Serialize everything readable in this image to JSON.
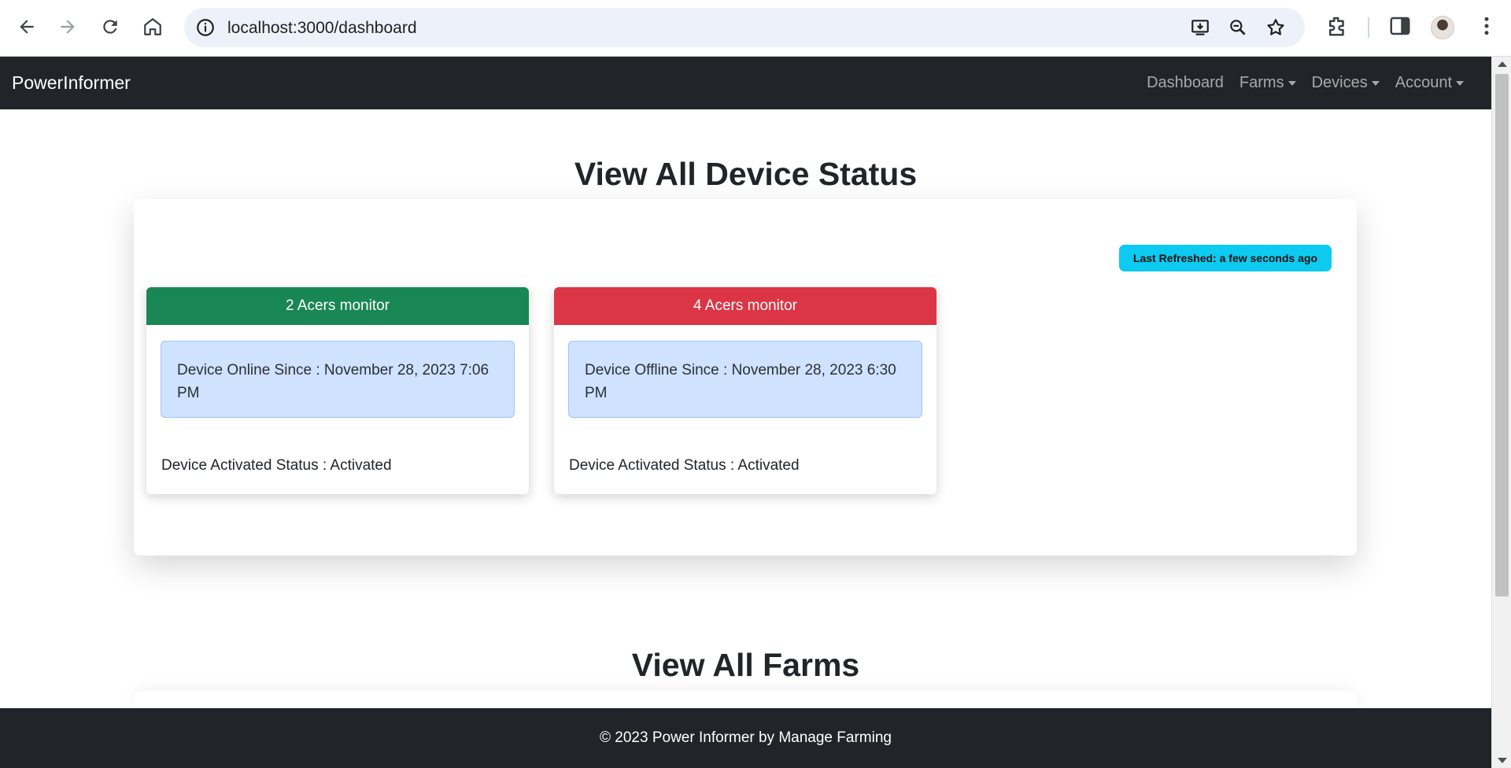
{
  "browser": {
    "url": "localhost:3000/dashboard",
    "icons": [
      "back-arrow-icon",
      "forward-arrow-icon",
      "reload-icon",
      "home-icon",
      "info-icon",
      "install-icon",
      "zoom-icon",
      "bookmark-star-icon",
      "extensions-icon",
      "side-panel-icon",
      "profile-avatar",
      "menu-kebab-icon"
    ]
  },
  "navbar": {
    "brand": "PowerInformer",
    "links": [
      {
        "label": "Dashboard",
        "dropdown": false
      },
      {
        "label": "Farms",
        "dropdown": true
      },
      {
        "label": "Devices",
        "dropdown": true
      },
      {
        "label": "Account",
        "dropdown": true
      }
    ]
  },
  "device_status": {
    "title": "View All Device Status",
    "last_refreshed": "Last Refreshed: a few seconds ago",
    "devices": [
      {
        "name": "2 Acers monitor",
        "status_color": "#198754",
        "since_text": "Device Online Since : November 28, 2023 7:06 PM",
        "activated_text": "Device Activated Status : Activated"
      },
      {
        "name": "4 Acers monitor",
        "status_color": "#dc3545",
        "since_text": "Device Offline Since : November 28, 2023 6:30 PM",
        "activated_text": "Device Activated Status : Activated"
      }
    ]
  },
  "farms": {
    "title": "View All Farms"
  },
  "footer": {
    "text": "© 2023 Power Informer by Manage Farming"
  },
  "colors": {
    "navbar_bg": "#212529",
    "badge_info": "#0dcaf0",
    "alert_primary_bg": "#cfe2ff"
  }
}
